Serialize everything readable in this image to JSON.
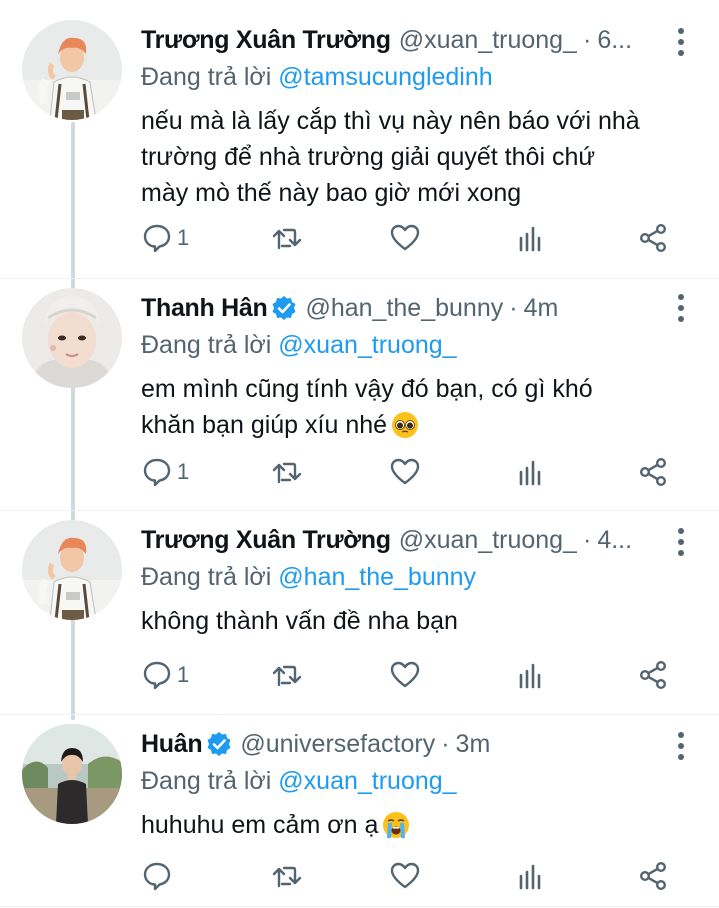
{
  "tweets": [
    {
      "display_name": "Trương Xuân Trường",
      "handle": "@xuan_truong_",
      "time": "6...",
      "verified": false,
      "reply_prefix": "Đang trả lời ",
      "reply_to": "@tamsucungledinh",
      "text_lines": [
        "nếu mà là lấy cắp thì vụ này nên báo với nhà",
        "trường để nhà trường giải quyết thôi chứ",
        "mày mò thế này bao giờ mới xong"
      ],
      "reply_count": "1",
      "avatar": "truong-avatar"
    },
    {
      "display_name": "Thanh Hân",
      "handle": "@han_the_bunny",
      "time": "4m",
      "verified": true,
      "reply_prefix": "Đang trả lời ",
      "reply_to": "@xuan_truong_",
      "text_lines": [
        "em mình cũng tính vậy đó bạn, có gì khó",
        "khăn bạn giúp xíu nhé"
      ],
      "emoji": "pleading-face-emoji",
      "reply_count": "1",
      "avatar": "han-avatar"
    },
    {
      "display_name": "Trương Xuân Trường",
      "handle": "@xuan_truong_",
      "time": "4...",
      "verified": false,
      "reply_prefix": "Đang trả lời ",
      "reply_to": "@han_the_bunny",
      "text_lines": [
        "không thành vấn đề nha bạn"
      ],
      "reply_count": "1",
      "avatar": "truong-avatar"
    },
    {
      "display_name": "Huân",
      "handle": "@universefactory",
      "time": "3m",
      "verified": true,
      "reply_prefix": "Đang trả lời ",
      "reply_to": "@xuan_truong_",
      "text_lines": [
        "huhuhu em cảm ơn ạ"
      ],
      "emoji": "loudly-crying-face-emoji",
      "reply_count": "",
      "avatar": "huan-avatar"
    }
  ],
  "separator": "·",
  "colors": {
    "text": "#0f1419",
    "secondary": "#536471",
    "link": "#1d9bf0",
    "thread_line": "#cfd9de"
  }
}
